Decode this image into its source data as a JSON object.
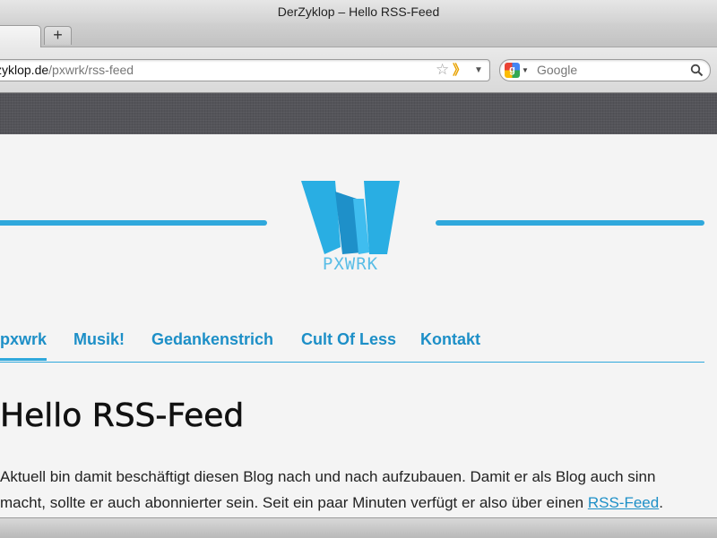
{
  "window": {
    "title": "DerZyklop – Hello RSS-Feed"
  },
  "tabs": {
    "new_tab_label": "+"
  },
  "address_bar": {
    "url_domain": "zyklop.de",
    "url_path": "/pxwrk/rss-feed",
    "icons": [
      "star-icon",
      "rss-icon",
      "chevron-down-icon"
    ]
  },
  "search_bar": {
    "engine_icon": "google-icon",
    "placeholder": "Google",
    "icon": "search-icon"
  },
  "site": {
    "logo_text": "PXWRK",
    "accent_color": "#2fa8dc",
    "nav": [
      {
        "label": "pxwrk",
        "active": true
      },
      {
        "label": "Musik!"
      },
      {
        "label": "Gedankenstrich"
      },
      {
        "label": "Cult Of Less"
      },
      {
        "label": "Kontakt"
      }
    ]
  },
  "article": {
    "title": "Hello RSS-Feed",
    "line1": "Aktuell bin damit beschäftigt diesen Blog nach und nach aufzubauen. Damit er als Blog auch sinn",
    "line2_text": "macht, sollte er auch abonnierter sein. Seit ein paar Minuten verfügt er also über einen ",
    "line2_link": "RSS-Feed",
    "line2_end": "."
  }
}
